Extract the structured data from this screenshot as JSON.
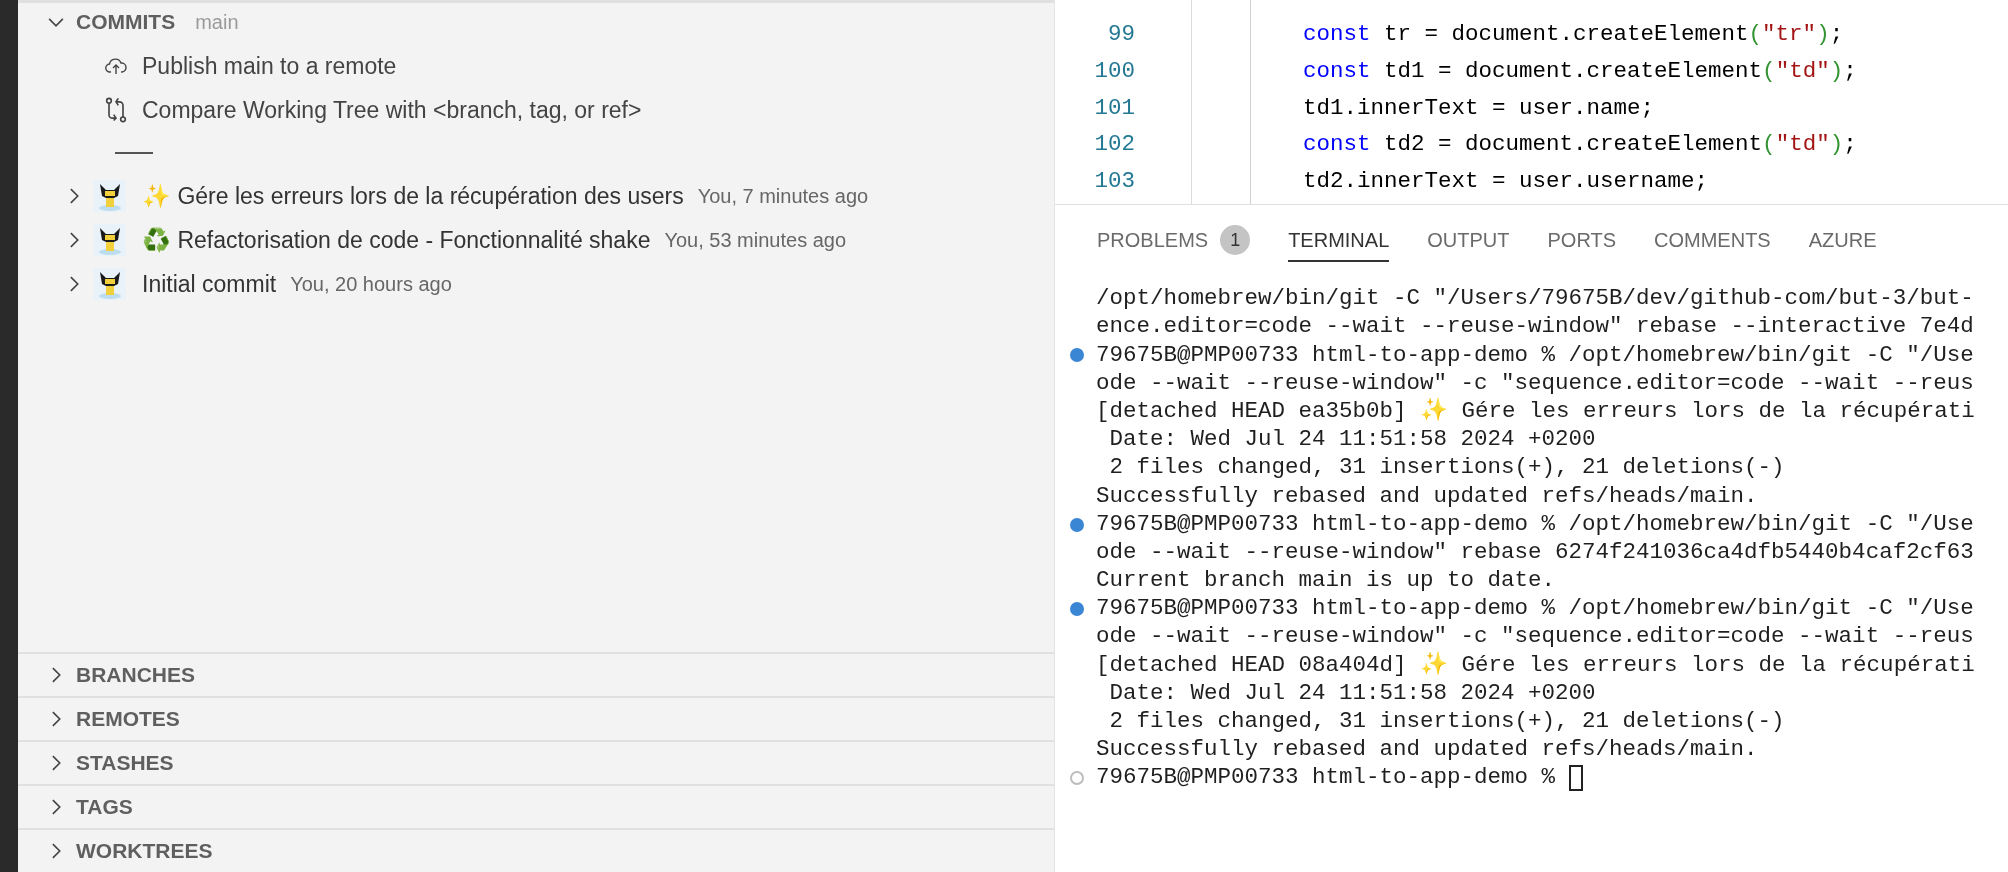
{
  "sidebar": {
    "sections": [
      {
        "title": "COMMITS",
        "expanded": true,
        "branch": "main",
        "actions": [
          {
            "kind": "publish",
            "label": "Publish main to a remote"
          },
          {
            "kind": "compare",
            "label": "Compare Working Tree with <branch, tag, or ref>"
          }
        ],
        "commits": [
          {
            "message": "✨ Gére les erreurs lors de la récupération des users",
            "meta": "You, 7 minutes ago",
            "expanded": false
          },
          {
            "message": "♻️ Refactorisation de code - Fonctionnalité shake",
            "meta": "You, 53 minutes ago",
            "expanded": false
          },
          {
            "message": "Initial commit",
            "meta": "You, 20 hours ago",
            "expanded": false
          }
        ]
      },
      {
        "title": "BRANCHES",
        "expanded": false
      },
      {
        "title": "REMOTES",
        "expanded": false
      },
      {
        "title": "STASHES",
        "expanded": false
      },
      {
        "title": "TAGS",
        "expanded": false
      },
      {
        "title": "WORKTREES",
        "expanded": false
      }
    ]
  },
  "editor": {
    "lines": [
      {
        "number": "99",
        "tokens": [
          {
            "t": "        const",
            "kind": "keyword"
          },
          {
            "t": " tr = document.createElement"
          },
          {
            "t": "(",
            "kind": "bracket"
          },
          {
            "t": "\"tr\"",
            "kind": "string"
          },
          {
            "t": ")",
            "kind": "bracket"
          },
          {
            "t": ";"
          }
        ]
      },
      {
        "number": "100",
        "tokens": [
          {
            "t": "        const",
            "kind": "keyword"
          },
          {
            "t": " td1 = document.createElement"
          },
          {
            "t": "(",
            "kind": "bracket"
          },
          {
            "t": "\"td\"",
            "kind": "string"
          },
          {
            "t": ")",
            "kind": "bracket"
          },
          {
            "t": ";"
          }
        ]
      },
      {
        "number": "101",
        "tokens": [
          {
            "t": "        td1.innerText = user.name;"
          }
        ]
      },
      {
        "number": "102",
        "tokens": [
          {
            "t": "        const",
            "kind": "keyword"
          },
          {
            "t": " td2 = document.createElement"
          },
          {
            "t": "(",
            "kind": "bracket"
          },
          {
            "t": "\"td\"",
            "kind": "string"
          },
          {
            "t": ")",
            "kind": "bracket"
          },
          {
            "t": ";"
          }
        ]
      },
      {
        "number": "103",
        "tokens": [
          {
            "t": "        td2.innerText = user.username;"
          }
        ]
      }
    ]
  },
  "panel": {
    "tabs": [
      {
        "label": "PROBLEMS",
        "badge": "1",
        "selected": false
      },
      {
        "label": "TERMINAL",
        "selected": true
      },
      {
        "label": "OUTPUT",
        "selected": false
      },
      {
        "label": "PORTS",
        "selected": false
      },
      {
        "label": "COMMENTS",
        "selected": false
      },
      {
        "label": "AZURE",
        "selected": false
      }
    ],
    "terminal": [
      {
        "text": "/opt/homebrew/bin/git -C \"/Users/79675B/dev/github-com/but-3/but-"
      },
      {
        "text": "ence.editor=code --wait --reuse-window\" rebase --interactive 7e4d"
      },
      {
        "text": "79675B@PMP00733 html-to-app-demo % /opt/homebrew/bin/git -C \"/Use",
        "finished": true
      },
      {
        "text": "ode --wait --reuse-window\" -c \"sequence.editor=code --wait --reus"
      },
      {
        "text": "[detached HEAD ea35b0b] ✨ Gére les erreurs lors de la récupérati"
      },
      {
        "text": " Date: Wed Jul 24 11:51:58 2024 +0200"
      },
      {
        "text": " 2 files changed, 31 insertions(+), 21 deletions(-)"
      },
      {
        "text": "Successfully rebased and updated refs/heads/main."
      },
      {
        "text": "79675B@PMP00733 html-to-app-demo % /opt/homebrew/bin/git -C \"/Use",
        "finished": true
      },
      {
        "text": "ode --wait --reuse-window\" rebase 6274f241036ca4dfb5440b4caf2cf63"
      },
      {
        "text": "Current branch main is up to date."
      },
      {
        "text": "79675B@PMP00733 html-to-app-demo % /opt/homebrew/bin/git -C \"/Use",
        "finished": true
      },
      {
        "text": "ode --wait --reuse-window\" -c \"sequence.editor=code --wait --reus"
      },
      {
        "text": "[detached HEAD 08a404d] ✨ Gére les erreurs lors de la récupérati"
      },
      {
        "text": " Date: Wed Jul 24 11:51:58 2024 +0200"
      },
      {
        "text": " 2 files changed, 31 insertions(+), 21 deletions(-)"
      },
      {
        "text": "Successfully rebased and updated refs/heads/main."
      },
      {
        "text": "79675B@PMP00733 html-to-app-demo % ",
        "finished": false,
        "cursor": true
      }
    ]
  }
}
